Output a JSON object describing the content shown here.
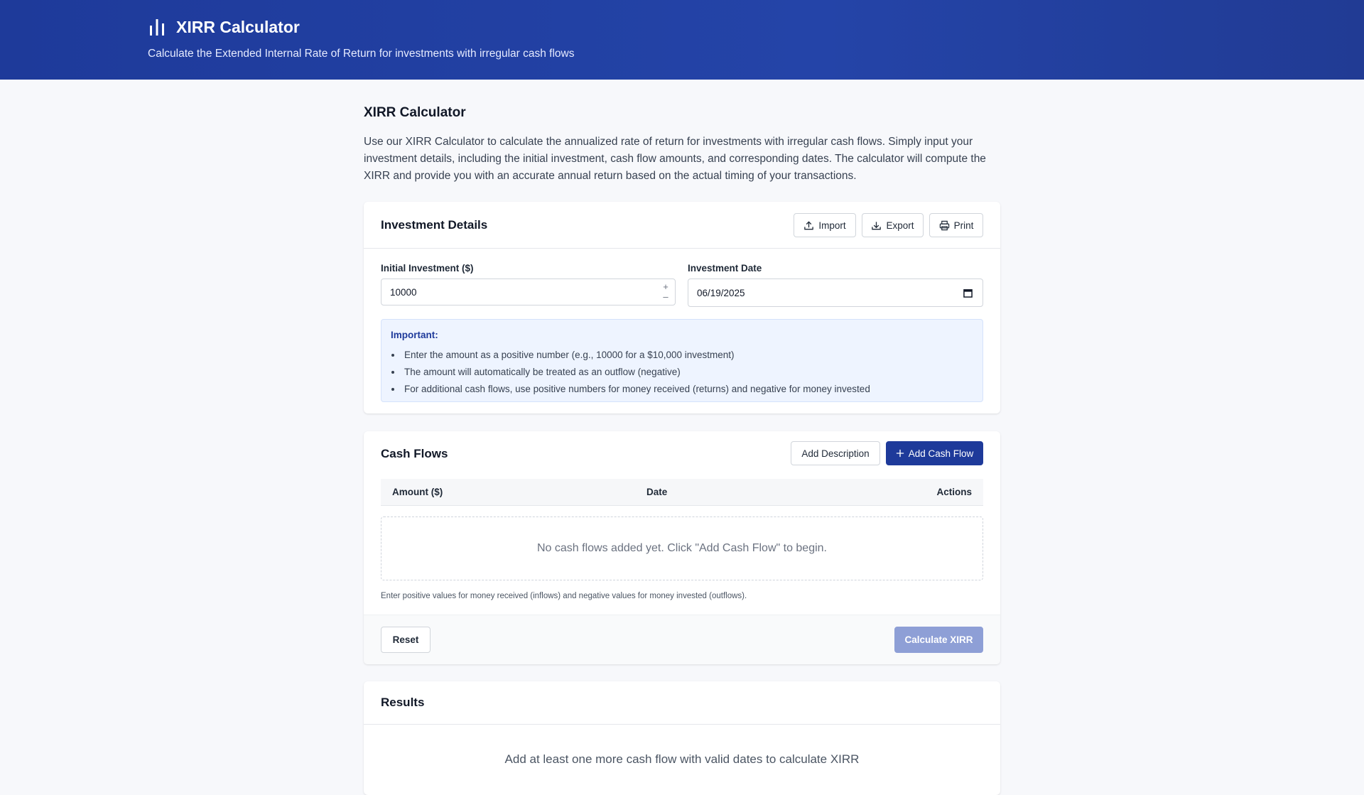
{
  "header": {
    "app_icon": "bar-chart-icon",
    "title": "XIRR Calculator",
    "subtitle": "Calculate the Extended Internal Rate of Return for investments with irregular cash flows"
  },
  "intro": {
    "title": "XIRR Calculator",
    "text": "Use our XIRR Calculator to calculate the annualized rate of return for investments with irregular cash flows. Simply input your investment details, including the initial investment, cash flow amounts, and corresponding dates. The calculator will compute the XIRR and provide you with an accurate annual return based on the actual timing of your transactions."
  },
  "investment": {
    "title": "Investment Details",
    "import_label": "Import",
    "export_label": "Export",
    "print_label": "Print",
    "initial_label": "Initial Investment ($)",
    "initial_value": "10000",
    "date_label": "Investment Date",
    "date_value": "06/19/2025",
    "note_title": "Important:",
    "note_items": [
      "Enter the amount as a positive number (e.g., 10000 for a $10,000 investment)",
      "The amount will automatically be treated as an outflow (negative)",
      "For additional cash flows, use positive numbers for money received (returns) and negative for money invested"
    ]
  },
  "cashflows": {
    "title": "Cash Flows",
    "add_description_label": "Add Description",
    "add_cashflow_label": "Add Cash Flow",
    "columns": [
      "Amount ($)",
      "Date",
      "Actions"
    ],
    "empty_text": "No cash flows added yet. Click \"Add Cash Flow\" to begin.",
    "hint": "Enter positive values for money received (inflows) and negative values for money invested (outflows).",
    "reset_label": "Reset",
    "calculate_label": "Calculate XIRR"
  },
  "results": {
    "title": "Results",
    "message": "Add at least one more cash flow with valid dates to calculate XIRR"
  },
  "colors": {
    "header_bg": "#1e3a9a",
    "primary": "#1e3a9a",
    "primary_disabled": "#8e9fd6",
    "note_bg": "#eef4ff"
  }
}
